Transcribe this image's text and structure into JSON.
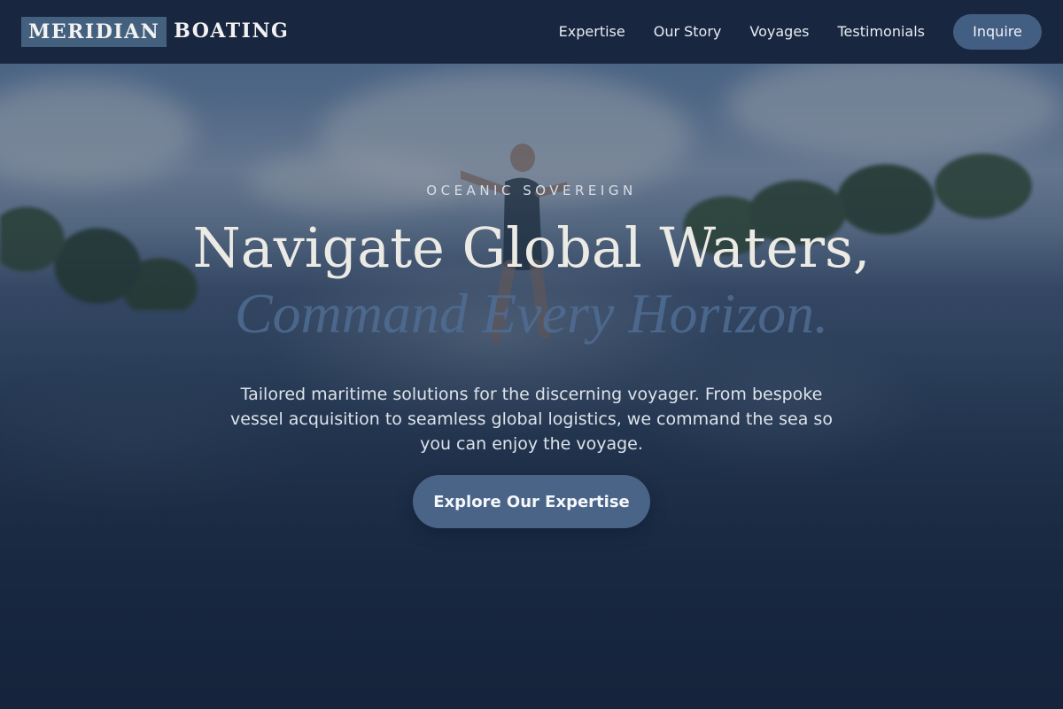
{
  "brand": {
    "logo_primary": "MERIDIAN",
    "logo_secondary": "BOATING"
  },
  "nav": {
    "links": [
      {
        "label": "Expertise"
      },
      {
        "label": "Our Story"
      },
      {
        "label": "Voyages"
      },
      {
        "label": "Testimonials"
      }
    ],
    "cta_label": "Inquire"
  },
  "hero": {
    "eyebrow": "OCEANIC SOVEREIGN",
    "headline": "Navigate Global Waters,",
    "headline_accent": "Command Every Horizon.",
    "lead": "Tailored maritime solutions for the discerning voyager. From bespoke vessel acquisition to seamless global logistics, we command the sea so you can enjoy the voyage.",
    "cta_label": "Explore Our Expertise",
    "background_image": "wakeboarder-on-lake"
  },
  "colors": {
    "nav_bg": "#182640",
    "accent": "#44607f",
    "button_bg": "#4a6488",
    "accent_text": "#4f6d93"
  }
}
